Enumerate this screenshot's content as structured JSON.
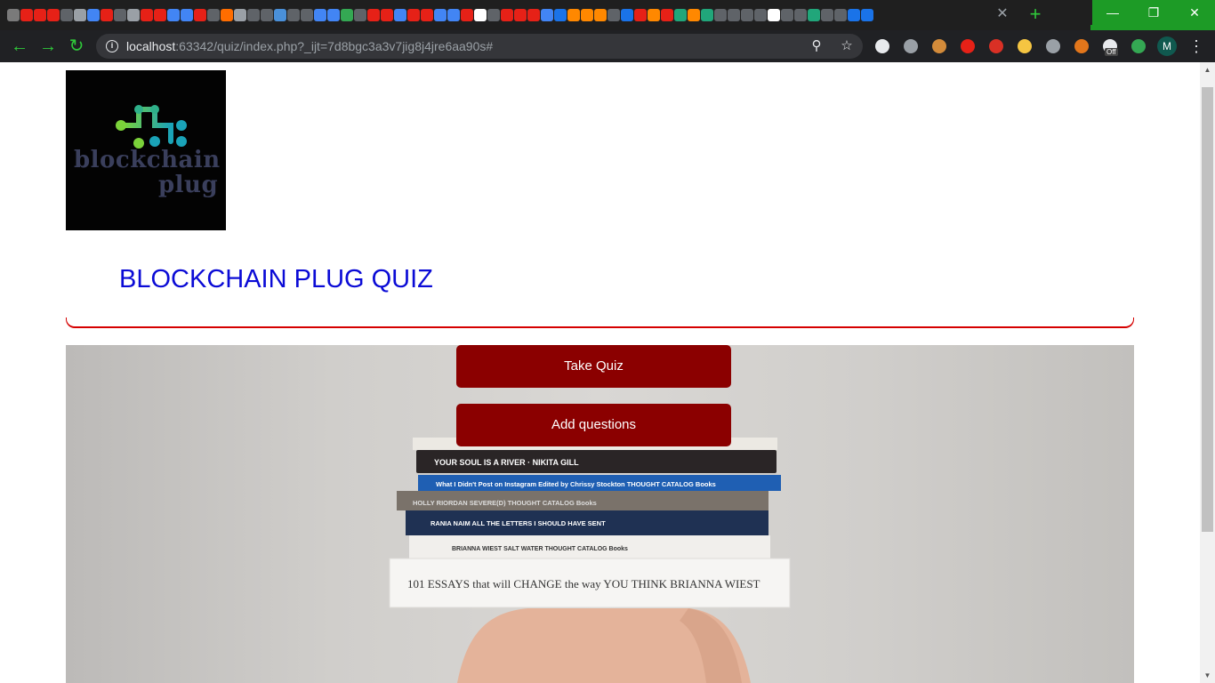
{
  "browser": {
    "tab_count_favicons": [
      "#7a7a7a",
      "#e62117",
      "#e62117",
      "#e62117",
      "#5f6368",
      "#9aa0a6",
      "#4285f4",
      "#e62117",
      "#5f6368",
      "#9aa0a6",
      "#e62117",
      "#e62117",
      "#4285f4",
      "#4285f4",
      "#e62117",
      "#5f6368",
      "#ff6d00",
      "#9aa0a6",
      "#5f6368",
      "#5f6368",
      "#4a90d9",
      "#5f6368",
      "#5f6368",
      "#4285f4",
      "#4285f4",
      "#34a853",
      "#5f6368",
      "#e62117",
      "#e62117",
      "#4285f4",
      "#e62117",
      "#e62117",
      "#4285f4",
      "#4285f4",
      "#e62117",
      "#ffffff",
      "#5f6368",
      "#e62117",
      "#e62117",
      "#e62117",
      "#4285f4",
      "#1a73e8",
      "#ff8800",
      "#ff8800",
      "#ff8800",
      "#5f6368",
      "#1a73e8",
      "#e62117",
      "#ff8800",
      "#e62117",
      "#21a67a",
      "#ff8800",
      "#21a67a",
      "#5f6368",
      "#5f6368",
      "#5f6368",
      "#5f6368",
      "#ffffff",
      "#5f6368",
      "#5f6368",
      "#21a67a",
      "#5f6368",
      "#5f6368",
      "#1a73e8",
      "#1a73e8"
    ],
    "tab_close_icon": "close-icon",
    "new_tab_icon": "plus-icon",
    "window": {
      "minimize": "—",
      "restore": "❐",
      "close": "✕"
    },
    "back_icon": "←",
    "forward_icon": "→",
    "reload_icon": "↻",
    "url_host": "localhost",
    "url_rest": ":63342/quiz/index.php?_ijt=7d8bgc3a3v7jig8j4jre6aa90s#",
    "zoom_icon": "⚲",
    "bookmark_icon": "☆",
    "extension_colors": [
      "#e8eaed",
      "#9aa0a6",
      "#d38b3a",
      "#e62117",
      "#d93025",
      "#f5c542",
      "#9aa0a6",
      "#e2761b",
      "#e8eaed",
      "#34a853"
    ],
    "extension_badge": "Off",
    "profile_initial": "M",
    "menu_icon": "⋮"
  },
  "page": {
    "logo": {
      "line1": "blockchain",
      "line2": "plug"
    },
    "title": "BLOCKCHAIN PLUG QUIZ",
    "buttons": {
      "take_quiz": "Take Quiz",
      "add_questions": "Add questions"
    },
    "colors": {
      "title": "#0b0bd6",
      "underline": "#d50000",
      "button_bg": "#8b0000"
    }
  },
  "hero": {
    "books": [
      "YOUR SOUL IS A RIVER · NIKITA GILL",
      "What I Didn't Post on Instagram    Edited by Chrissy Stockton    THOUGHT CATALOG Books",
      "HOLLY RIORDAN    SEVERE(D)    THOUGHT CATALOG Books",
      "RANIA NAIM    ALL THE LETTERS I SHOULD HAVE SENT",
      "BRIANNA WIEST    SALT WATER    THOUGHT CATALOG Books",
      "101 ESSAYS that will CHANGE the way YOU THINK    BRIANNA WIEST"
    ]
  }
}
